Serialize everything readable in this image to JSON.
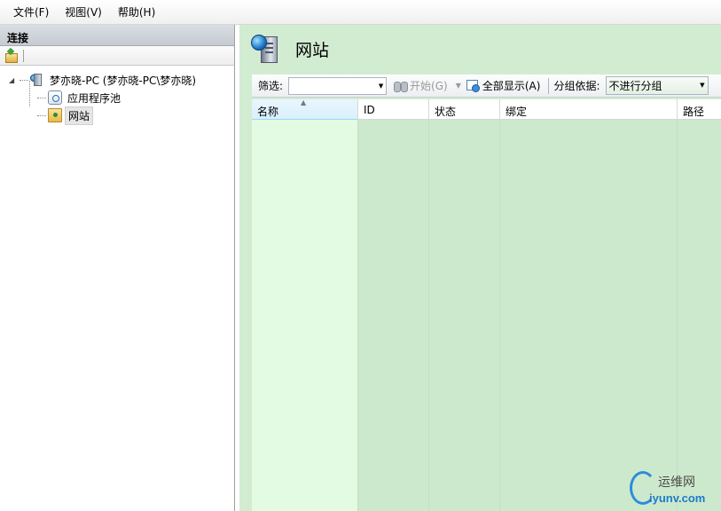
{
  "menu": {
    "items": [
      {
        "label": "文件(F)"
      },
      {
        "label": "视图(V)"
      },
      {
        "label": "帮助(H)"
      }
    ]
  },
  "connections": {
    "title": "连接",
    "toolbar": {
      "icon": "connect-icon"
    },
    "tree": {
      "server": {
        "label": "梦亦晓-PC (梦亦晓-PC\\梦亦晓)",
        "icon": "server-icon",
        "expander": "◢"
      },
      "children": [
        {
          "label": "应用程序池",
          "icon": "app-pool-icon"
        },
        {
          "label": "网站",
          "icon": "sites-folder-icon",
          "selected": true
        }
      ]
    }
  },
  "main": {
    "title": "网站",
    "icon": "web-server-icon",
    "filter": {
      "label": "筛选:",
      "value": "",
      "go_label": "开始(G)",
      "show_all_label": "全部显示(A)",
      "group_by_label": "分组依据:",
      "group_by_value": "不进行分组"
    },
    "table": {
      "columns": [
        {
          "label": "名称",
          "sorted": true
        },
        {
          "label": "ID"
        },
        {
          "label": "状态"
        },
        {
          "label": "绑定"
        },
        {
          "label": "路径"
        }
      ],
      "rows": []
    }
  },
  "watermark": {
    "line1": "运维网",
    "line2": "iyunv.com"
  },
  "colors": {
    "content_bg": "#d2ecd2",
    "sorted_col_bg": "#e2fbe2",
    "header_bg": "#c6cad1"
  }
}
